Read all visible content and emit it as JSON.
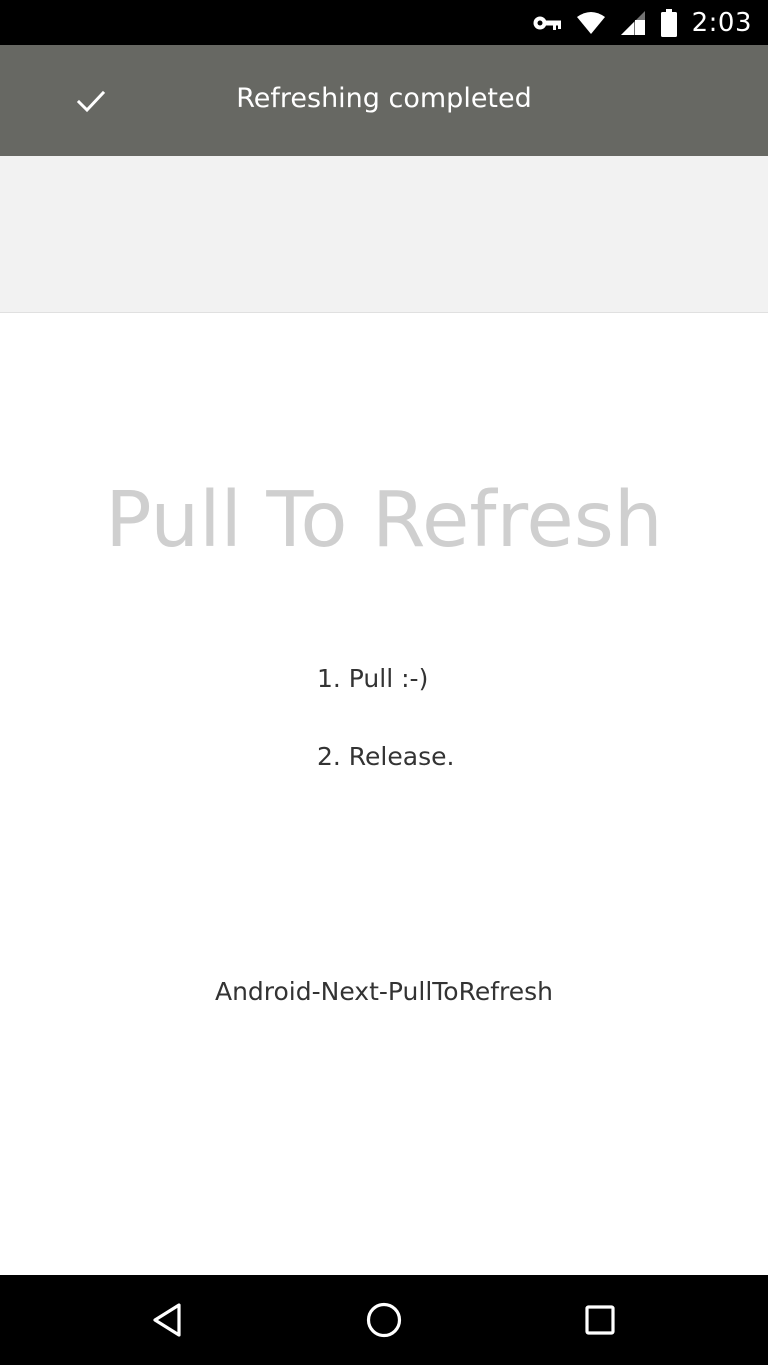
{
  "status_bar": {
    "time": "2:03",
    "icons": [
      "vpn-key-icon",
      "wifi-icon",
      "cell-signal-icon",
      "battery-icon"
    ]
  },
  "refresh_header": {
    "icon": "check-icon",
    "text": "Refreshing completed",
    "background": "#676863"
  },
  "main": {
    "title": "Pull To Refresh",
    "steps": [
      "1. Pull :-)",
      "2. Release."
    ],
    "footer_label": "Android-Next-PullToRefresh"
  },
  "nav_bar": {
    "buttons": [
      "back-icon",
      "home-icon",
      "recents-icon"
    ]
  }
}
